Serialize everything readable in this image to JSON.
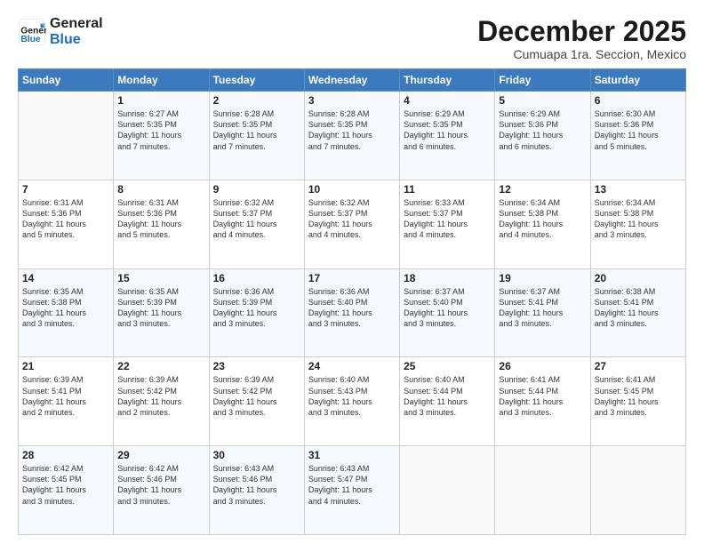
{
  "header": {
    "logo_line1": "General",
    "logo_line2": "Blue",
    "month": "December 2025",
    "location": "Cumuapa 1ra. Seccion, Mexico"
  },
  "weekdays": [
    "Sunday",
    "Monday",
    "Tuesday",
    "Wednesday",
    "Thursday",
    "Friday",
    "Saturday"
  ],
  "weeks": [
    [
      {
        "day": "",
        "info": ""
      },
      {
        "day": "1",
        "info": "Sunrise: 6:27 AM\nSunset: 5:35 PM\nDaylight: 11 hours\nand 7 minutes."
      },
      {
        "day": "2",
        "info": "Sunrise: 6:28 AM\nSunset: 5:35 PM\nDaylight: 11 hours\nand 7 minutes."
      },
      {
        "day": "3",
        "info": "Sunrise: 6:28 AM\nSunset: 5:35 PM\nDaylight: 11 hours\nand 7 minutes."
      },
      {
        "day": "4",
        "info": "Sunrise: 6:29 AM\nSunset: 5:35 PM\nDaylight: 11 hours\nand 6 minutes."
      },
      {
        "day": "5",
        "info": "Sunrise: 6:29 AM\nSunset: 5:36 PM\nDaylight: 11 hours\nand 6 minutes."
      },
      {
        "day": "6",
        "info": "Sunrise: 6:30 AM\nSunset: 5:36 PM\nDaylight: 11 hours\nand 5 minutes."
      }
    ],
    [
      {
        "day": "7",
        "info": "Sunrise: 6:31 AM\nSunset: 5:36 PM\nDaylight: 11 hours\nand 5 minutes."
      },
      {
        "day": "8",
        "info": "Sunrise: 6:31 AM\nSunset: 5:36 PM\nDaylight: 11 hours\nand 5 minutes."
      },
      {
        "day": "9",
        "info": "Sunrise: 6:32 AM\nSunset: 5:37 PM\nDaylight: 11 hours\nand 4 minutes."
      },
      {
        "day": "10",
        "info": "Sunrise: 6:32 AM\nSunset: 5:37 PM\nDaylight: 11 hours\nand 4 minutes."
      },
      {
        "day": "11",
        "info": "Sunrise: 6:33 AM\nSunset: 5:37 PM\nDaylight: 11 hours\nand 4 minutes."
      },
      {
        "day": "12",
        "info": "Sunrise: 6:34 AM\nSunset: 5:38 PM\nDaylight: 11 hours\nand 4 minutes."
      },
      {
        "day": "13",
        "info": "Sunrise: 6:34 AM\nSunset: 5:38 PM\nDaylight: 11 hours\nand 3 minutes."
      }
    ],
    [
      {
        "day": "14",
        "info": "Sunrise: 6:35 AM\nSunset: 5:38 PM\nDaylight: 11 hours\nand 3 minutes."
      },
      {
        "day": "15",
        "info": "Sunrise: 6:35 AM\nSunset: 5:39 PM\nDaylight: 11 hours\nand 3 minutes."
      },
      {
        "day": "16",
        "info": "Sunrise: 6:36 AM\nSunset: 5:39 PM\nDaylight: 11 hours\nand 3 minutes."
      },
      {
        "day": "17",
        "info": "Sunrise: 6:36 AM\nSunset: 5:40 PM\nDaylight: 11 hours\nand 3 minutes."
      },
      {
        "day": "18",
        "info": "Sunrise: 6:37 AM\nSunset: 5:40 PM\nDaylight: 11 hours\nand 3 minutes."
      },
      {
        "day": "19",
        "info": "Sunrise: 6:37 AM\nSunset: 5:41 PM\nDaylight: 11 hours\nand 3 minutes."
      },
      {
        "day": "20",
        "info": "Sunrise: 6:38 AM\nSunset: 5:41 PM\nDaylight: 11 hours\nand 3 minutes."
      }
    ],
    [
      {
        "day": "21",
        "info": "Sunrise: 6:39 AM\nSunset: 5:41 PM\nDaylight: 11 hours\nand 2 minutes."
      },
      {
        "day": "22",
        "info": "Sunrise: 6:39 AM\nSunset: 5:42 PM\nDaylight: 11 hours\nand 2 minutes."
      },
      {
        "day": "23",
        "info": "Sunrise: 6:39 AM\nSunset: 5:42 PM\nDaylight: 11 hours\nand 3 minutes."
      },
      {
        "day": "24",
        "info": "Sunrise: 6:40 AM\nSunset: 5:43 PM\nDaylight: 11 hours\nand 3 minutes."
      },
      {
        "day": "25",
        "info": "Sunrise: 6:40 AM\nSunset: 5:44 PM\nDaylight: 11 hours\nand 3 minutes."
      },
      {
        "day": "26",
        "info": "Sunrise: 6:41 AM\nSunset: 5:44 PM\nDaylight: 11 hours\nand 3 minutes."
      },
      {
        "day": "27",
        "info": "Sunrise: 6:41 AM\nSunset: 5:45 PM\nDaylight: 11 hours\nand 3 minutes."
      }
    ],
    [
      {
        "day": "28",
        "info": "Sunrise: 6:42 AM\nSunset: 5:45 PM\nDaylight: 11 hours\nand 3 minutes."
      },
      {
        "day": "29",
        "info": "Sunrise: 6:42 AM\nSunset: 5:46 PM\nDaylight: 11 hours\nand 3 minutes."
      },
      {
        "day": "30",
        "info": "Sunrise: 6:43 AM\nSunset: 5:46 PM\nDaylight: 11 hours\nand 3 minutes."
      },
      {
        "day": "31",
        "info": "Sunrise: 6:43 AM\nSunset: 5:47 PM\nDaylight: 11 hours\nand 4 minutes."
      },
      {
        "day": "",
        "info": ""
      },
      {
        "day": "",
        "info": ""
      },
      {
        "day": "",
        "info": ""
      }
    ]
  ]
}
